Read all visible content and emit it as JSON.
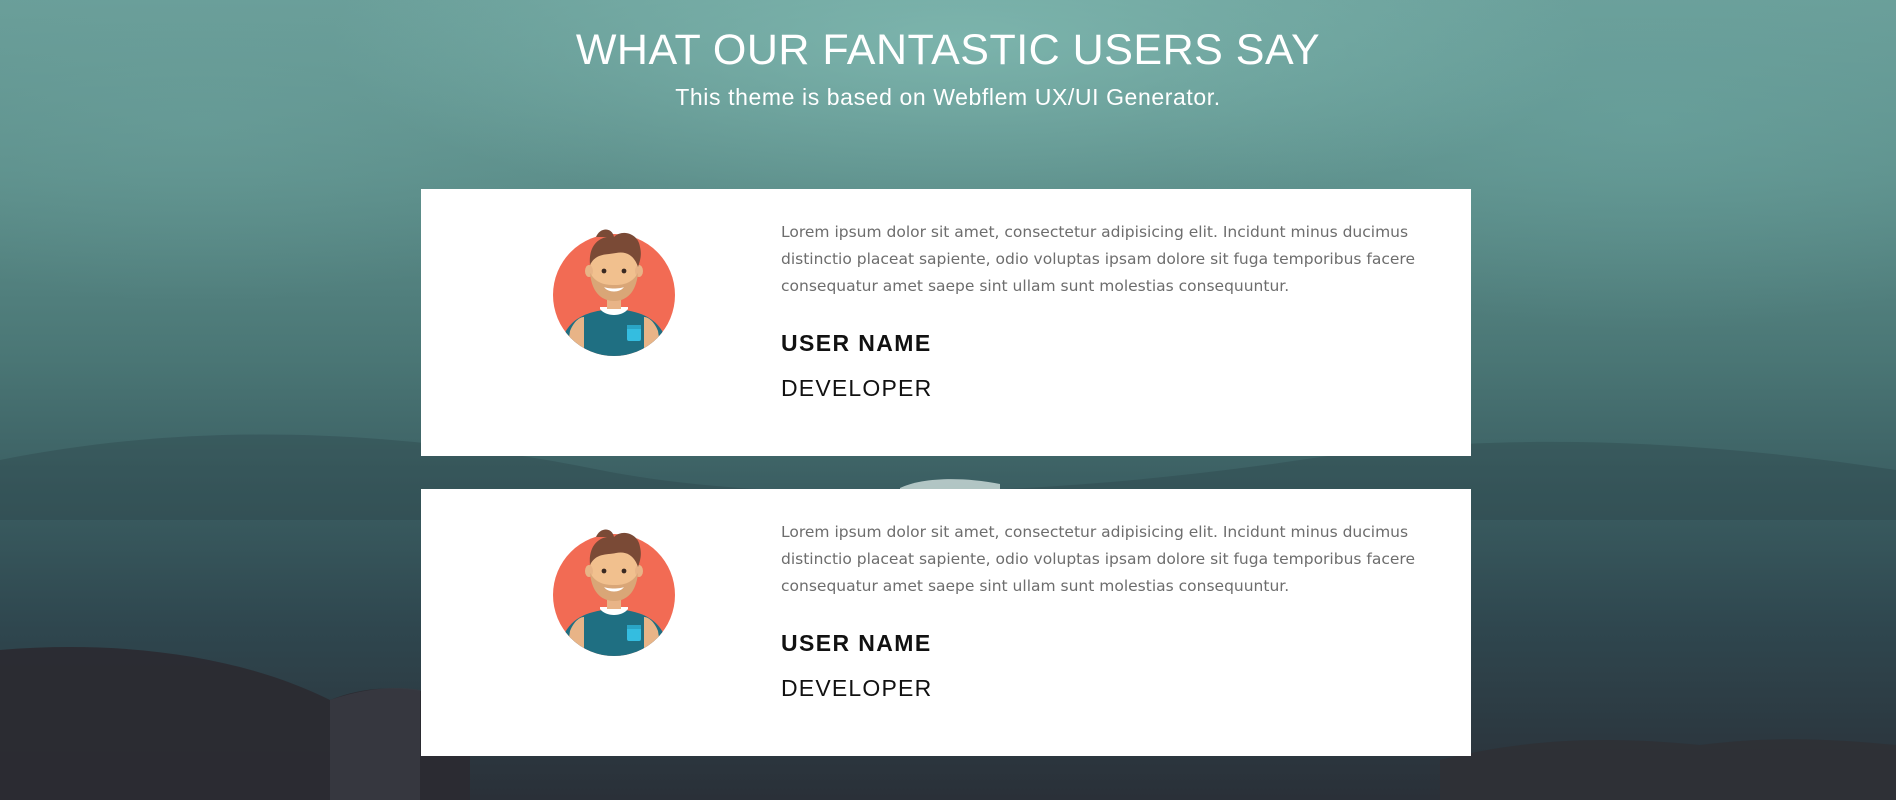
{
  "header": {
    "title": "WHAT OUR FANTASTIC USERS SAY",
    "subtitle": "This theme is based on Webflem UX/UI Generator."
  },
  "testimonials": [
    {
      "quote": "Lorem ipsum dolor sit amet, consectetur adipisicing elit. Incidunt minus ducimus distinctio placeat sapiente, odio voluptas ipsam dolore sit fuga temporibus facere consequatur amet saepe sint ullam sunt molestias consequuntur.",
      "name": "USER NAME",
      "role": "DEVELOPER",
      "avatar_icon": "user-avatar-icon"
    },
    {
      "quote": "Lorem ipsum dolor sit amet, consectetur adipisicing elit. Incidunt minus ducimus distinctio placeat sapiente, odio voluptas ipsam dolore sit fuga temporibus facere consequatur amet saepe sint ullam sunt molestias consequuntur.",
      "name": "USER NAME",
      "role": "DEVELOPER",
      "avatar_icon": "user-avatar-icon"
    }
  ],
  "colors": {
    "avatar_circle": "#f26b54",
    "shirt": "#1f6f82",
    "pocket": "#34bde0",
    "hair": "#7a4a36",
    "skin": "#f1c08e"
  }
}
